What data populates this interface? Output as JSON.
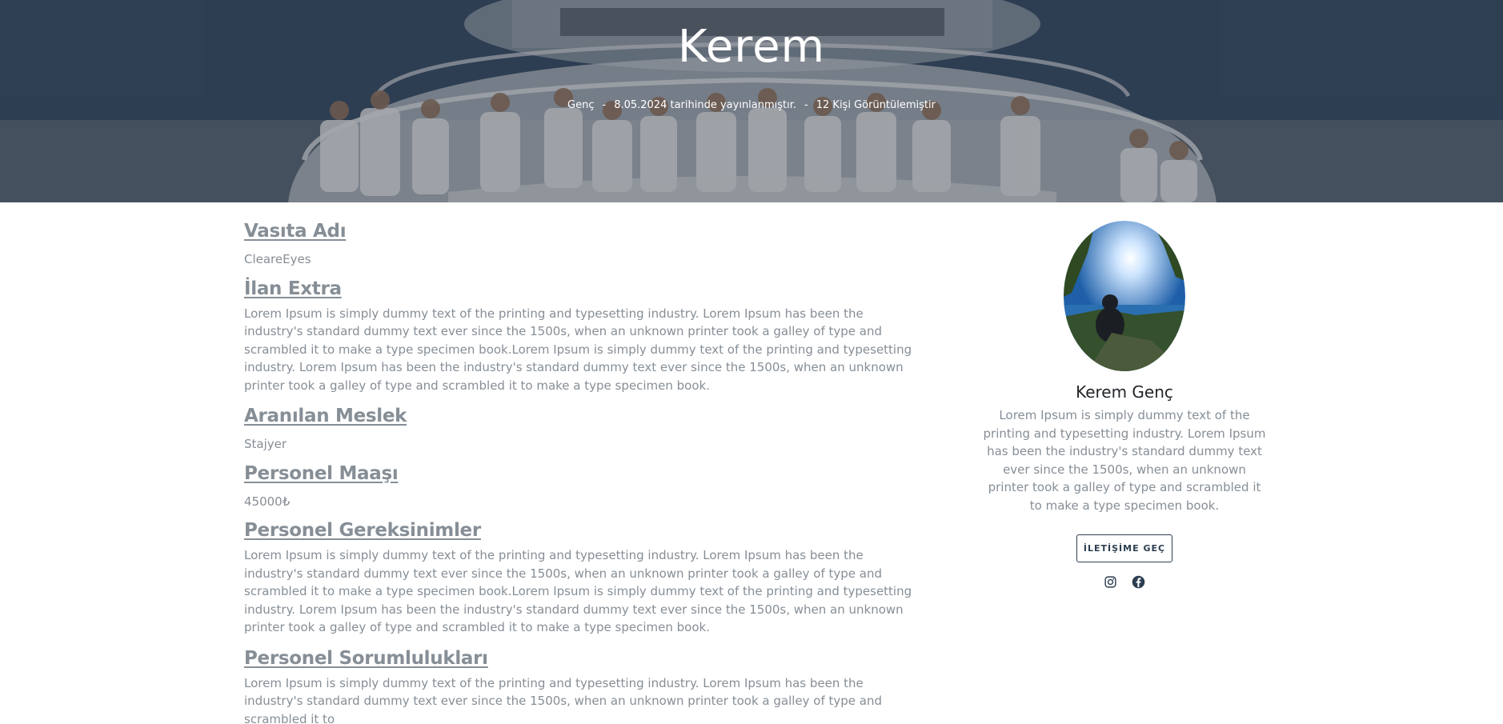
{
  "hero": {
    "title": "Kerem",
    "author": "Genç",
    "separator": "-",
    "published": "8.05.2024 tarihinde yayınlanmıştır.",
    "views": "12 Kişi Görüntülemiştir"
  },
  "sections": [
    {
      "title": "Vasıta Adı",
      "body": "CleareEyes"
    },
    {
      "title": "İlan Extra",
      "body": "Lorem Ipsum is simply dummy text of the printing and typesetting industry. Lorem Ipsum has been the industry's standard dummy text ever since the 1500s, when an unknown printer took a galley of type and scrambled it to make a type specimen book.Lorem Ipsum is simply dummy text of the printing and typesetting industry. Lorem Ipsum has been the industry's standard dummy text ever since the 1500s, when an unknown printer took a galley of type and scrambled it to make a type specimen book."
    },
    {
      "title": "Aranılan Meslek",
      "body": "Stajyer"
    },
    {
      "title": "Personel Maaşı",
      "body": "45000₺"
    },
    {
      "title": "Personel Gereksinimler",
      "body": "Lorem Ipsum is simply dummy text of the printing and typesetting industry. Lorem Ipsum has been the industry's standard dummy text ever since the 1500s, when an unknown printer took a galley of type and scrambled it to make a type specimen book.Lorem Ipsum is simply dummy text of the printing and typesetting industry. Lorem Ipsum has been the industry's standard dummy text ever since the 1500s, when an unknown printer took a galley of type and scrambled it to make a type specimen book."
    },
    {
      "title": "Personel Sorumlulukları",
      "body": "Lorem Ipsum is simply dummy text of the printing and typesetting industry. Lorem Ipsum has been the industry's standard dummy text ever since the 1500s, when an unknown printer took a galley of type and scrambled it to"
    }
  ],
  "sidebar": {
    "name": "Kerem Genç",
    "bio": "Lorem Ipsum is simply dummy text of the printing and typesetting industry. Lorem Ipsum has been the industry's standard dummy text ever since the 1500s, when an unknown printer took a galley of type and scrambled it to make a type specimen book.",
    "contact_label": "İLETİŞİME GEÇ",
    "social_icons": [
      "instagram-icon",
      "facebook-icon"
    ]
  },
  "colors": {
    "text_muted": "#868e96",
    "text_dark": "#212529",
    "button_border": "#2c3e50"
  }
}
